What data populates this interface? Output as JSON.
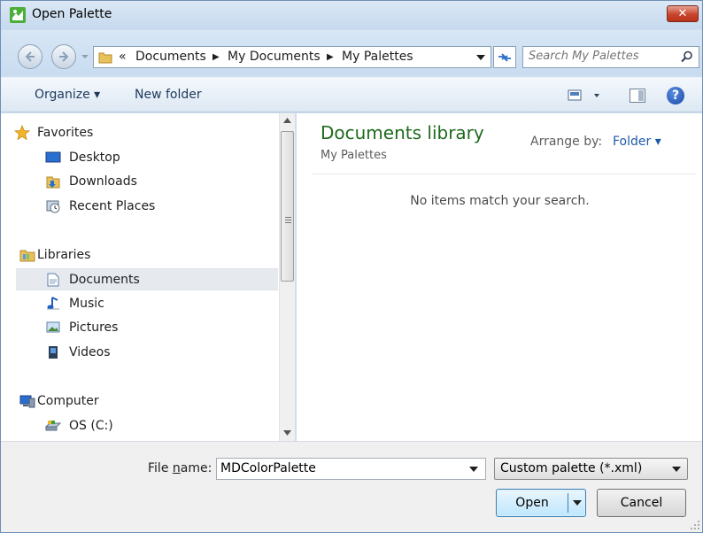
{
  "window": {
    "title": "Open Palette",
    "close_label": "✕"
  },
  "address": {
    "overflow": "«",
    "crumbs": [
      "Documents",
      "My Documents",
      "My Palettes"
    ],
    "separator": "▶"
  },
  "search": {
    "placeholder": "Search My Palettes"
  },
  "toolbar": {
    "organize": "Organize ▾",
    "new_folder": "New folder",
    "help": "?"
  },
  "nav": {
    "favorites": "Favorites",
    "desktop": "Desktop",
    "downloads": "Downloads",
    "recent": "Recent Places",
    "libraries": "Libraries",
    "documents": "Documents",
    "music": "Music",
    "pictures": "Pictures",
    "videos": "Videos",
    "computer": "Computer",
    "os_drive": "OS (C:)"
  },
  "content": {
    "title": "Documents library",
    "subtitle": "My Palettes",
    "arrange_label": "Arrange by:",
    "arrange_value": "Folder ▾",
    "empty_message": "No items match your search."
  },
  "footer": {
    "filename_label_prefix": "File ",
    "filename_label_accel": "n",
    "filename_label_suffix": "ame:",
    "filename_value": "MDColorPalette",
    "filetype_value": "Custom palette (*.xml)",
    "open_label": "Open",
    "cancel_label": "Cancel"
  },
  "colors": {
    "accent_title": "#1e6b1e",
    "link": "#1e5aa8",
    "close_red": "#c8452c",
    "frame": "#cfdff0"
  }
}
